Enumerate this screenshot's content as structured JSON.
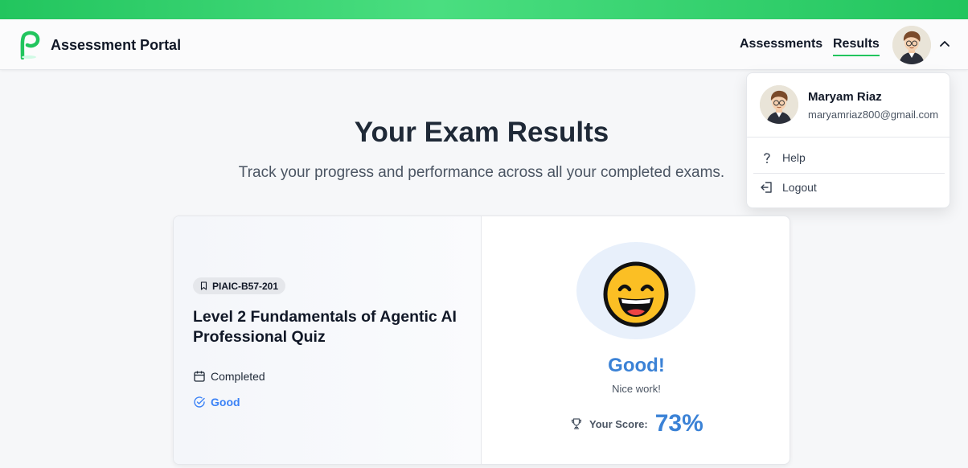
{
  "header": {
    "app_name": "Assessment Portal",
    "nav": [
      {
        "label": "Assessments",
        "active": false
      },
      {
        "label": "Results",
        "active": true
      }
    ],
    "accent_color": "#22c55e"
  },
  "user_menu": {
    "name": "Maryam Riaz",
    "email": "maryamriaz800@gmail.com",
    "items": [
      {
        "label": "Help",
        "icon": "question-icon"
      },
      {
        "label": "Logout",
        "icon": "logout-icon"
      }
    ]
  },
  "page": {
    "title": "Your Exam Results",
    "subtitle": "Track your progress and performance across all your completed exams."
  },
  "result_card": {
    "code": "PIAIC-B57-201",
    "exam_title": "Level 2 Fundamentals of Agentic AI Professional Quiz",
    "status": "Completed",
    "grade": "Good",
    "grade_heading": "Good!",
    "grade_message": "Nice work!",
    "score_label": "Your Score:",
    "score": "73%",
    "score_color": "#3b82d6"
  }
}
